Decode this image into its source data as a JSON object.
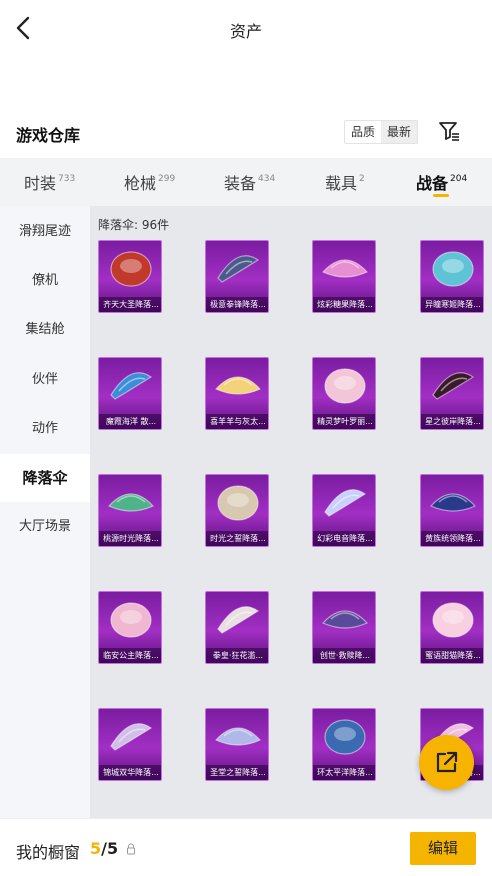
{
  "header": {
    "title": "资产"
  },
  "section": {
    "title": "游戏仓库",
    "sort_quality": "品质",
    "sort_latest": "最新"
  },
  "tabs": [
    {
      "label": "时装",
      "count": "733"
    },
    {
      "label": "枪械",
      "count": "299"
    },
    {
      "label": "装备",
      "count": "434"
    },
    {
      "label": "载具",
      "count": "2"
    },
    {
      "label": "战备",
      "count": "204"
    }
  ],
  "sidebar": {
    "items": [
      "滑翔尾迹",
      "僚机",
      "集结舱",
      "伙伴",
      "动作",
      "降落伞",
      "大厅场景"
    ],
    "active_index": 5
  },
  "grid": {
    "count_label": "降落伞: 96件",
    "items": [
      {
        "name": "齐天大圣降落...",
        "palette": "#c0392b"
      },
      {
        "name": "极意拳锋降落...",
        "palette": "#4a5a8a"
      },
      {
        "name": "炫彩糖果降落...",
        "palette": "#e78fd0"
      },
      {
        "name": "异瞳寒姬降落...",
        "palette": "#5fc3d6"
      },
      {
        "name": "魔霞海洋 散...",
        "palette": "#3a8fd8"
      },
      {
        "name": "喜羊羊与灰太...",
        "palette": "#f3d27a"
      },
      {
        "name": "精灵梦叶罗丽...",
        "palette": "#f2c6d6"
      },
      {
        "name": "星之彼岸降落...",
        "palette": "#3a1a2a"
      },
      {
        "name": "桃源时光降落...",
        "palette": "#4fb38a"
      },
      {
        "name": "时光之誓降落...",
        "palette": "#d8c8b0"
      },
      {
        "name": "幻彩电音降落...",
        "palette": "#c8d0ff"
      },
      {
        "name": "黄族统领降落...",
        "palette": "#2a3a8a"
      },
      {
        "name": "临安公主降落...",
        "palette": "#f0b8d0"
      },
      {
        "name": "拳皇·狂花滥...",
        "palette": "#e8e0e0"
      },
      {
        "name": "创世·救赎降...",
        "palette": "#5a4a9a"
      },
      {
        "name": "蜜语甜猫降落...",
        "palette": "#f8d0e0"
      },
      {
        "name": "锦城双华降落...",
        "palette": "#d0c0e8"
      },
      {
        "name": "圣堂之誓降落...",
        "palette": "#b0b8e8"
      },
      {
        "name": "环太平洋降落...",
        "palette": "#3a6ab0"
      },
      {
        "name": "粉蝶之翼降落...",
        "palette": "#f0c0e0"
      }
    ]
  },
  "bottom": {
    "label": "我的橱窗",
    "current": "5",
    "total": "/5",
    "edit_label": "编辑"
  },
  "colors": {
    "accent": "#f5b400",
    "card": "#a22fc4"
  }
}
